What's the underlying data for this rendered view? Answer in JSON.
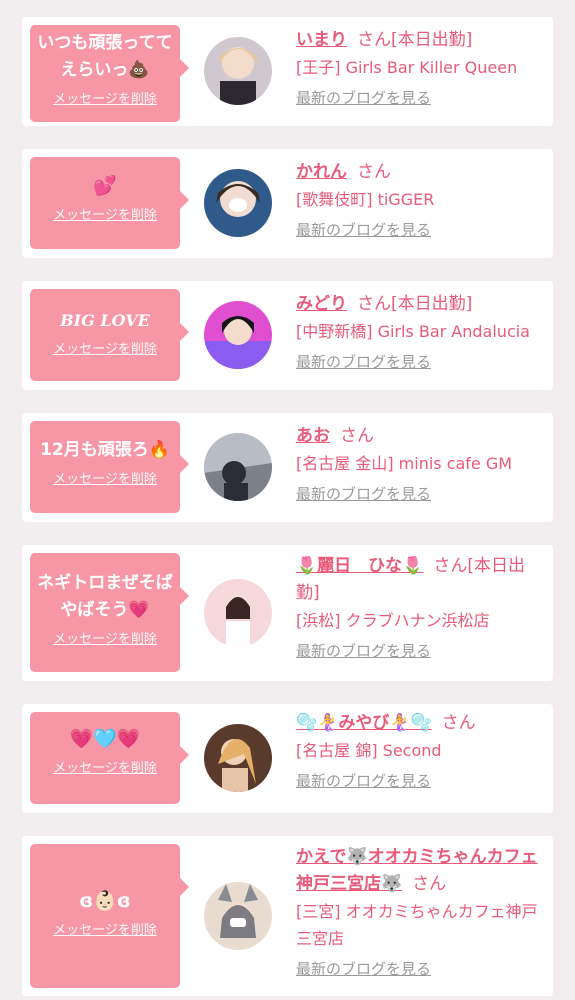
{
  "cards": [
    {
      "message": "いつも頑張ってて\nえらいっ💩",
      "delete_label": "メッセージを削除",
      "name": "いまり",
      "san": "さん",
      "status": "[本日出勤]",
      "shop": "[王子] Girls Bar Killer Queen",
      "blog_label": "最新のブログを見る"
    },
    {
      "message": "💕",
      "delete_label": "メッセージを削除",
      "name": "かれん",
      "san": "さん",
      "status": "",
      "shop": "[歌舞伎町] tiGGER",
      "blog_label": "最新のブログを見る"
    },
    {
      "message": "BIG LOVE",
      "delete_label": "メッセージを削除",
      "name": "みどり",
      "san": "さん",
      "status": "[本日出勤]",
      "shop": "[中野新橋] Girls Bar Andalucia",
      "blog_label": "最新のブログを見る"
    },
    {
      "message": "12月も頑張ろ🔥",
      "delete_label": "メッセージを削除",
      "name": "あお",
      "san": "さん",
      "status": "",
      "shop": "[名古屋 金山] minis cafe GM",
      "blog_label": "最新のブログを見る"
    },
    {
      "message": "ネギトロまぜそば\nやばそう💗",
      "delete_label": "メッセージを削除",
      "name": "🌷麗日　ひな🌷",
      "san": "さん",
      "status": "[本日出勤]",
      "shop": "[浜松] クラブハナン浜松店",
      "blog_label": "最新のブログを見る"
    },
    {
      "message": "💗🩵💗",
      "delete_label": "メッセージを削除",
      "name": "🫧🧜‍♀️みやび🧜‍♀️🫧",
      "san": "さん",
      "status": "",
      "shop": "[名古屋 錦] Second",
      "blog_label": "最新のブログを見る"
    },
    {
      "message": "ɞ👶🏻ɞ",
      "delete_label": "メッセージを削除",
      "name": "かえで🐺オオカミちゃんカフェ神戸三宮店🐺",
      "san": "さん",
      "status": "",
      "shop": "[三宮] オオカミちゃんカフェ神戸三宮店",
      "blog_label": "最新のブログを見る"
    }
  ],
  "colors": {
    "accent": "#e85b7a",
    "bubble": "#f797a6",
    "link_gray": "#9a9a9a",
    "background": "#f2eeef"
  }
}
